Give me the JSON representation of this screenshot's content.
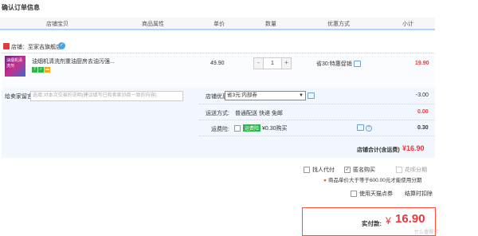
{
  "page_title": "确认订单信息",
  "columns": {
    "shop_item": "店铺宝贝",
    "attrs": "商品属性",
    "price": "单价",
    "qty": "数量",
    "promo": "优惠方式",
    "subtotal": "小计"
  },
  "shop": {
    "label": "店铺：",
    "name": "至家吉旗舰店"
  },
  "item": {
    "thumb_text": "油烟机清洗剂",
    "name": "油烟机清洗剂重油厨房去油污强...",
    "price": "49.90",
    "quantity": "1",
    "minus": "-",
    "plus": "+",
    "promo": "省30:特惠促销",
    "subtotal": "19.90"
  },
  "message": {
    "label": "给卖家留言：",
    "placeholder": "选填:对本次交易的说明(建议填写已和卖家协商一致的内容)"
  },
  "shop_discount": {
    "label": "店铺优惠:",
    "selected": "省3元:内部券",
    "value": "-3.00"
  },
  "shipping": {
    "label": "运送方式:",
    "text": "普通配送 快递 免邮",
    "value": "0.00"
  },
  "insurance": {
    "label": "运费险:",
    "badge": "运费险",
    "text": "¥0.30购买",
    "value": "0.30"
  },
  "shop_total": {
    "label": "店铺合计(含运费)",
    "value": "¥16.90"
  },
  "options": {
    "friend_pay": "找人代付",
    "anonymous": "匿名购买",
    "installment": "花呗分期"
  },
  "installment_note": "商品单价大于等于600.00元才能使用分期",
  "tmall_points": "使用天猫点券",
  "points_calc": "结算时扣除",
  "final": {
    "label": "实付款:",
    "currency": "¥",
    "amount": "16.90"
  },
  "watermark": "什么值得买"
}
